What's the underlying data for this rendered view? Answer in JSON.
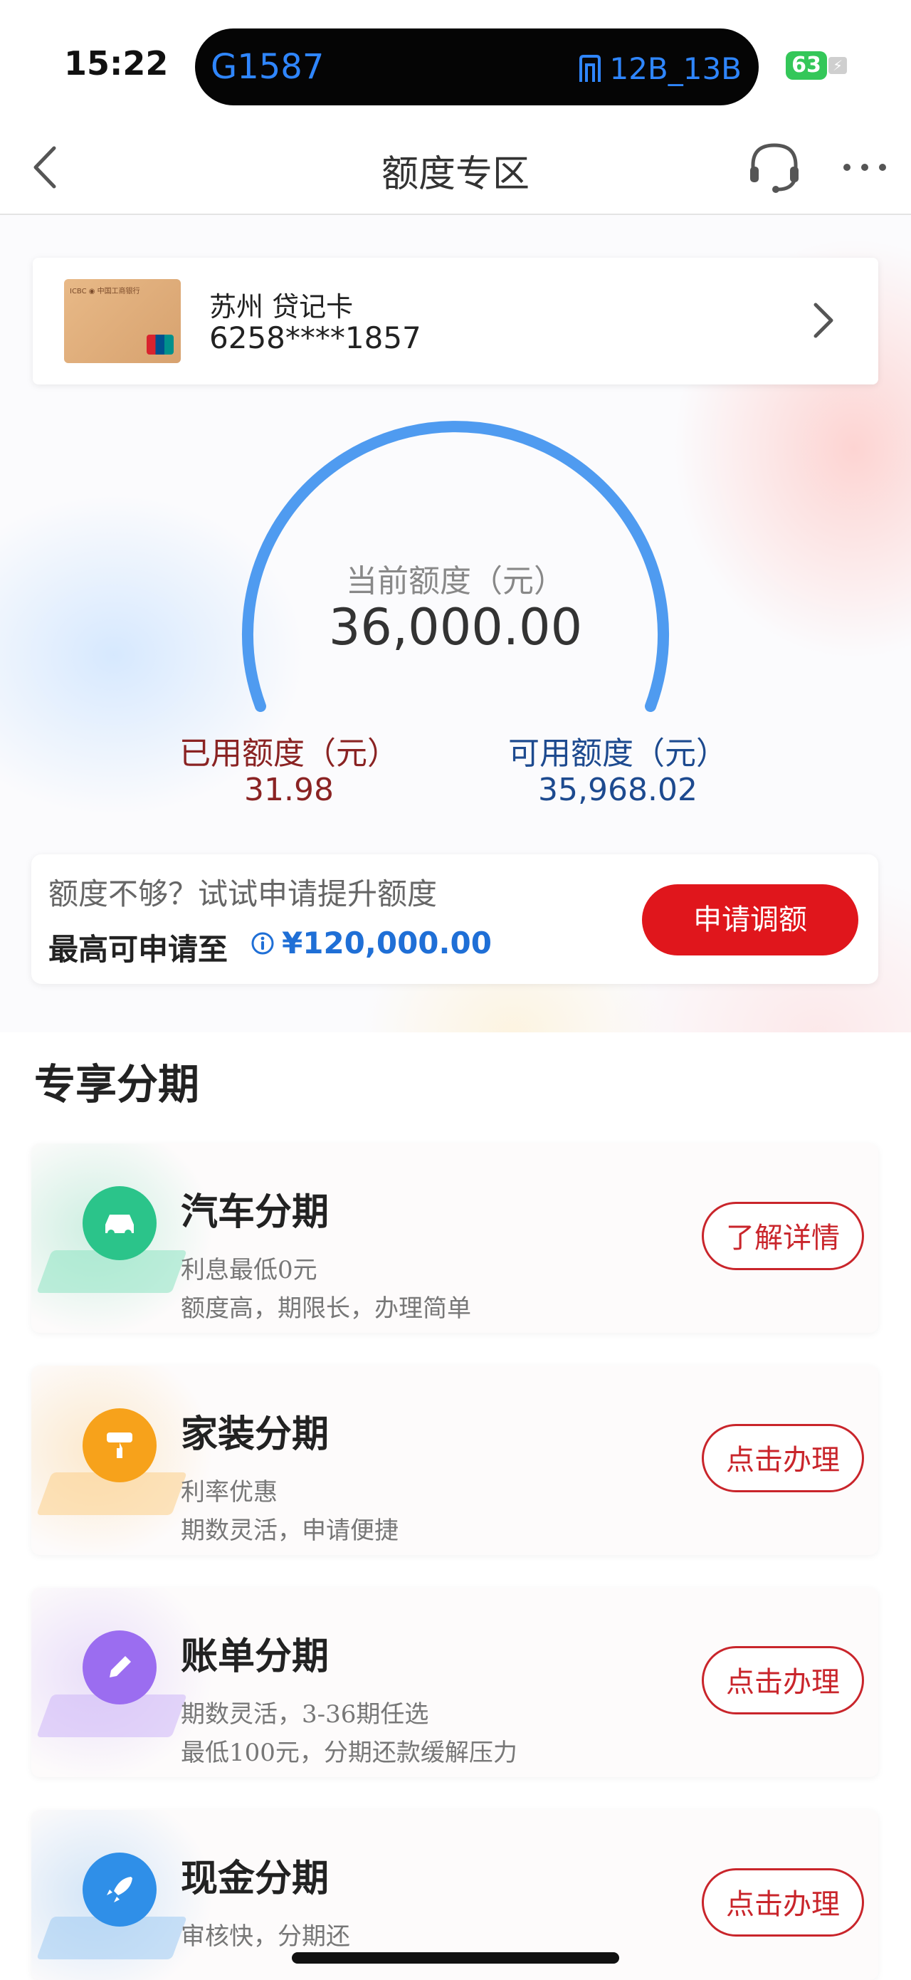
{
  "status_bar": {
    "time": "15:22",
    "train": "G1587",
    "gate": "12B_13B",
    "battery": "63"
  },
  "nav": {
    "title": "额度专区",
    "icons": [
      "back-chevron-icon",
      "customer-service-headset-icon",
      "more-dots-icon"
    ]
  },
  "card": {
    "name": "苏州 贷记卡",
    "number": "6258****1857"
  },
  "limit": {
    "current_label": "当前额度（元）",
    "current_value": "36,000.00",
    "used_label": "已用额度（元）",
    "used_value": "31.98",
    "available_label": "可用额度（元）",
    "available_value": "35,968.02",
    "used_color": "#8a2323",
    "available_color": "#1d4a8f",
    "gauge_color": "#4f9bf0"
  },
  "increase": {
    "hint": "额度不够？试试申请提升额度",
    "max_label": "最高可申请至",
    "max_value": "¥120,000.00",
    "button": "申请调额",
    "button_color": "#e0161c"
  },
  "section": {
    "title": "专享分期"
  },
  "installments": [
    {
      "title": "汽车分期",
      "line1": "利息最低0元",
      "line2": "额度高，期限长，办理简单",
      "button": "了解详情",
      "icon": "car-icon",
      "color": "#2bc48a"
    },
    {
      "title": "家装分期",
      "line1": "利率优惠",
      "line2": "期数灵活，申请便捷",
      "button": "点击办理",
      "icon": "paint-roller-icon",
      "color": "#f7a21b"
    },
    {
      "title": "账单分期",
      "line1": "期数灵活，3-36期任选",
      "line2": "最低100元，分期还款缓解压力",
      "button": "点击办理",
      "icon": "pencil-icon",
      "color": "#9b6df0"
    },
    {
      "title": "现金分期",
      "line1": "审核快，分期还",
      "line2": "",
      "button": "点击办理",
      "icon": "rocket-icon",
      "color": "#2f8fe8"
    }
  ]
}
